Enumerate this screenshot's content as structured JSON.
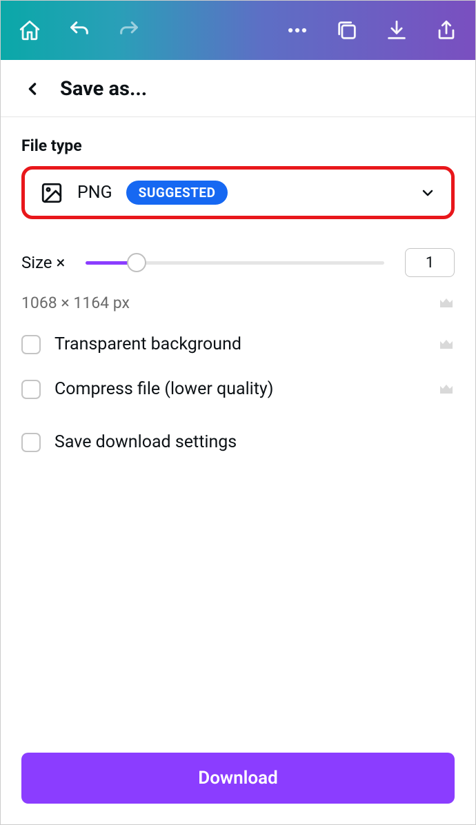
{
  "header": {
    "title": "Save as..."
  },
  "fileType": {
    "label": "File type",
    "selected": "PNG",
    "badge": "SUGGESTED"
  },
  "size": {
    "label": "Size ×",
    "value": "1",
    "dimensions": "1068 × 1164 px"
  },
  "options": {
    "transparent": "Transparent background",
    "compress": "Compress file (lower quality)",
    "saveSettings": "Save download settings"
  },
  "download": "Download"
}
